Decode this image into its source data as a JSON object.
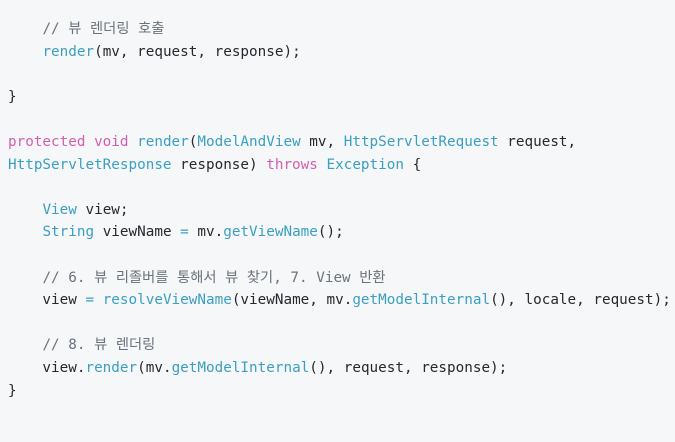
{
  "code": {
    "lines": [
      [
        {
          "t": "    "
        },
        {
          "t": "// 뷰 렌더링 호출",
          "k": "comment"
        }
      ],
      [
        {
          "t": "    "
        },
        {
          "t": "render",
          "k": "func"
        },
        {
          "t": "(mv, request, response);"
        }
      ],
      [],
      [
        {
          "t": "}"
        }
      ],
      [],
      [
        {
          "t": "protected",
          "k": "keyword"
        },
        {
          "t": " "
        },
        {
          "t": "void",
          "k": "keyword"
        },
        {
          "t": " "
        },
        {
          "t": "render",
          "k": "func"
        },
        {
          "t": "("
        },
        {
          "t": "ModelAndView",
          "k": "type"
        },
        {
          "t": " mv, "
        },
        {
          "t": "HttpServletRequest",
          "k": "type"
        },
        {
          "t": " request,"
        }
      ],
      [
        {
          "t": "HttpServletResponse",
          "k": "type"
        },
        {
          "t": " response) "
        },
        {
          "t": "throws",
          "k": "keyword"
        },
        {
          "t": " "
        },
        {
          "t": "Exception",
          "k": "type"
        },
        {
          "t": " {"
        }
      ],
      [],
      [
        {
          "t": "    "
        },
        {
          "t": "View",
          "k": "type"
        },
        {
          "t": " view;"
        }
      ],
      [
        {
          "t": "    "
        },
        {
          "t": "String",
          "k": "type"
        },
        {
          "t": " viewName "
        },
        {
          "t": "=",
          "k": "op"
        },
        {
          "t": " mv."
        },
        {
          "t": "getViewName",
          "k": "func"
        },
        {
          "t": "();"
        }
      ],
      [],
      [
        {
          "t": "    "
        },
        {
          "t": "// 6. 뷰 리졸버를 통해서 뷰 찾기, 7. View 반환",
          "k": "comment"
        }
      ],
      [
        {
          "t": "    view "
        },
        {
          "t": "=",
          "k": "op"
        },
        {
          "t": " "
        },
        {
          "t": "resolveViewName",
          "k": "func"
        },
        {
          "t": "(viewName, mv."
        },
        {
          "t": "getModelInternal",
          "k": "func"
        },
        {
          "t": "(), locale, request);"
        }
      ],
      [],
      [
        {
          "t": "    "
        },
        {
          "t": "// 8. 뷰 렌더링",
          "k": "comment"
        }
      ],
      [
        {
          "t": "    view."
        },
        {
          "t": "render",
          "k": "func"
        },
        {
          "t": "(mv."
        },
        {
          "t": "getModelInternal",
          "k": "func"
        },
        {
          "t": "(), request, response);"
        }
      ],
      [
        {
          "t": "}"
        }
      ]
    ]
  }
}
